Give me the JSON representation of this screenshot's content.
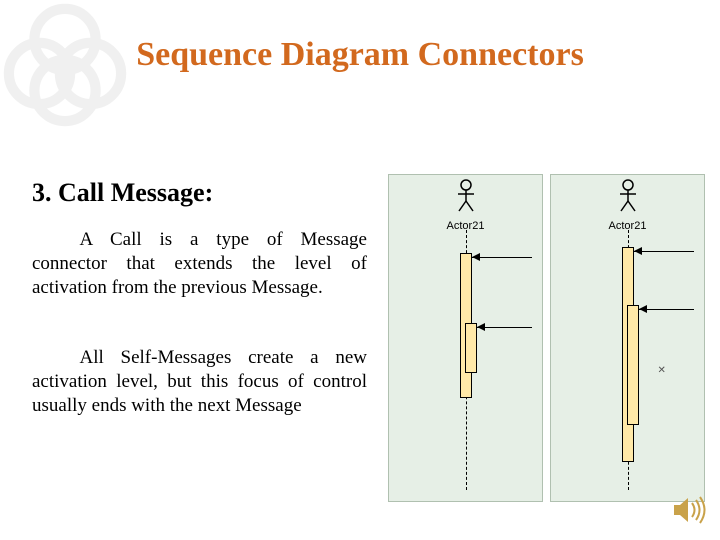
{
  "title": "Sequence Diagram Connectors",
  "subtitle": "3. Call Message:",
  "paragraph1": "A Call is a type of Message connector that extends the level of activation from the previous Message.",
  "paragraph2": "All Self-Messages create a new activation level, but this focus of control usually ends with the next Message",
  "figure_left": {
    "actor_label": "Actor21"
  },
  "figure_right": {
    "actor_label": "Actor21",
    "cross_label": "✕"
  }
}
